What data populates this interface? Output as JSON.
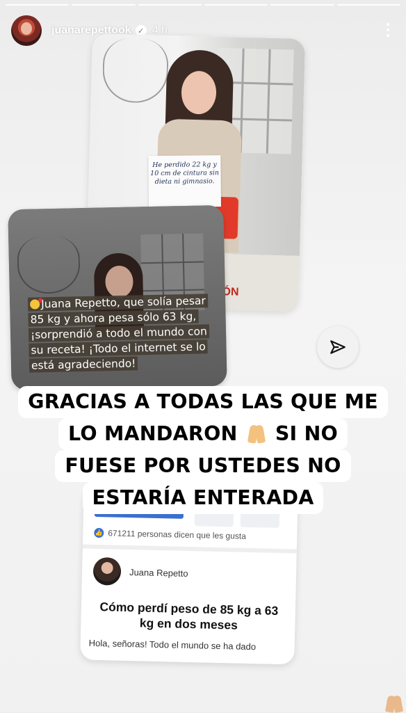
{
  "story": {
    "username": "juanarepettook",
    "verified_icon": "verified-badge-icon",
    "time_ago": "4 h",
    "progress_segments": 6
  },
  "card_top": {
    "sign_text": "He perdido 22 kg y 10 cm de cintura sin dieta ni gimnasio.",
    "cta_fragment": "IÓN"
  },
  "card_left": {
    "quote": "Juana Repetto, que solía pesar 85 kg y ahora pesa sólo 63 kg, ¡sorprendió a todo el mundo con su receta! ¡Todo el internet se lo está agradeciendo!"
  },
  "caption": {
    "line1": "GRACIAS A TODAS LAS QUE ME",
    "line2a": "LO MANDARON",
    "line2b": "SI NO",
    "line3": "FUESE POR USTEDES NO",
    "line4": "ESTARÍA ENTERADA"
  },
  "card_bottom": {
    "likes": "671211 personas dicen que les gusta",
    "author": "Juana Repetto",
    "title": "Cómo perdí peso de 85 kg a 63 kg en dos meses",
    "snippet": "Hola, señoras! Todo el mundo se ha dado"
  }
}
